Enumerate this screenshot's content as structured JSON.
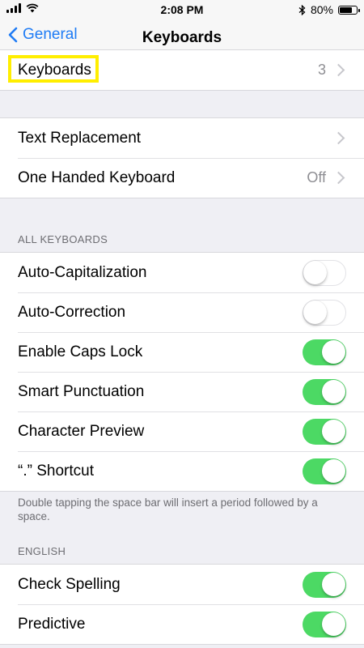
{
  "status_bar": {
    "time": "2:08 PM",
    "battery_percent": "80%",
    "battery_level": 0.8,
    "icons": [
      "cellular-signal-icon",
      "wifi-icon",
      "bluetooth-icon",
      "battery-icon"
    ]
  },
  "nav": {
    "back_label": "General",
    "title": "Keyboards"
  },
  "groups": {
    "keyboards": {
      "label": "Keyboards",
      "value": "3"
    },
    "text": {
      "text_replacement": "Text Replacement",
      "one_handed": "One Handed Keyboard",
      "one_handed_value": "Off"
    }
  },
  "all_keyboards": {
    "header": "ALL KEYBOARDS",
    "items": [
      {
        "label": "Auto-Capitalization",
        "on": false
      },
      {
        "label": "Auto-Correction",
        "on": false
      },
      {
        "label": "Enable Caps Lock",
        "on": true
      },
      {
        "label": "Smart Punctuation",
        "on": true
      },
      {
        "label": "Character Preview",
        "on": true
      },
      {
        "label": "“.” Shortcut",
        "on": true
      }
    ],
    "footer": "Double tapping the space bar will insert a period followed by a space."
  },
  "english": {
    "header": "ENGLISH",
    "items": [
      {
        "label": "Check Spelling",
        "on": true
      },
      {
        "label": "Predictive",
        "on": true
      }
    ]
  },
  "colors": {
    "accent": "#1f7cf5",
    "toggle_on": "#4cd964",
    "highlight": "#ffee00",
    "background": "#efeff4"
  }
}
